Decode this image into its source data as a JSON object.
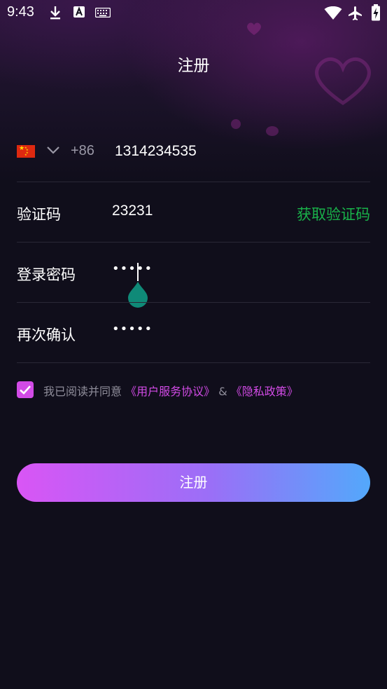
{
  "status_bar": {
    "time": "9:43",
    "left_icons": [
      "download-icon",
      "font-a-icon",
      "keyboard-icon"
    ],
    "right_icons": [
      "wifi-icon",
      "airplane-icon",
      "battery-charging-icon"
    ]
  },
  "header": {
    "title": "注册"
  },
  "form": {
    "phone": {
      "flag_icon": "china-flag-icon",
      "country_code": "+86",
      "value": "1314234535"
    },
    "verification": {
      "label": "验证码",
      "value": "23231",
      "get_code_label": "获取验证码",
      "get_code_color": "#19b24a"
    },
    "password": {
      "label": "登录密码",
      "value": "•••••"
    },
    "confirm_password": {
      "label": "再次确认",
      "value": "•••••"
    }
  },
  "agreement": {
    "checked": true,
    "prefix": "我已阅读并同意",
    "user_agreement": "《用户服务协议》",
    "connector": "&",
    "privacy_policy": "《隐私政策》",
    "link_color": "#d24be6"
  },
  "actions": {
    "register_label": "注册"
  },
  "colors": {
    "background": "#100e1b",
    "accent": "#d24be6",
    "button_gradient_start": "#d955f5",
    "button_gradient_end": "#53a8fb"
  }
}
